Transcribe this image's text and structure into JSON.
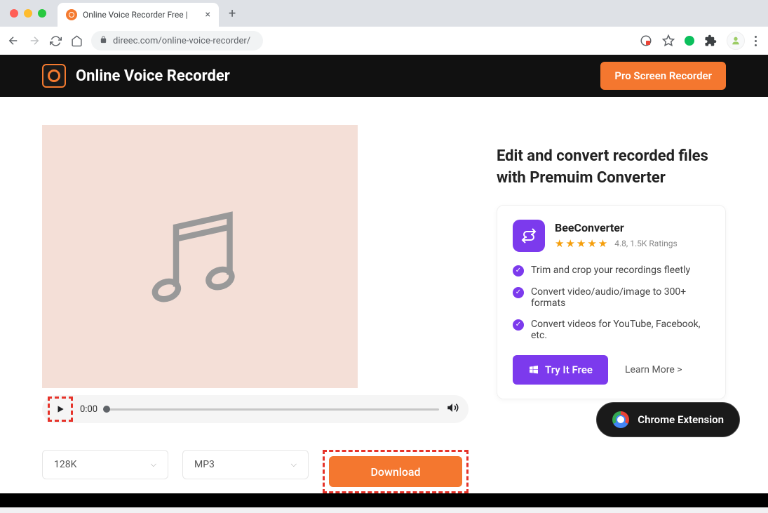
{
  "browser": {
    "tab_title": "Online Voice Recorder Free |",
    "url": "direec.com/online-voice-recorder/"
  },
  "header": {
    "brand": "Online Voice Recorder",
    "pro_button": "Pro Screen Recorder"
  },
  "player": {
    "time": "0:00"
  },
  "selects": {
    "bitrate": "128K",
    "format": "MP3"
  },
  "download_label": "Download",
  "right": {
    "headline": "Edit and convert recorded files with Premuim Converter",
    "promo": {
      "name": "BeeConverter",
      "rating_text": "4.8, 1.5K Ratings",
      "features": [
        "Trim and crop your recordings fleetly",
        "Convert video/audio/image to 300+ formats",
        "Convert videos for YouTube, Facebook, etc."
      ],
      "try_label": "Try It Free",
      "learn_label": "Learn More >"
    }
  },
  "chrome_ext_label": "Chrome Extension"
}
